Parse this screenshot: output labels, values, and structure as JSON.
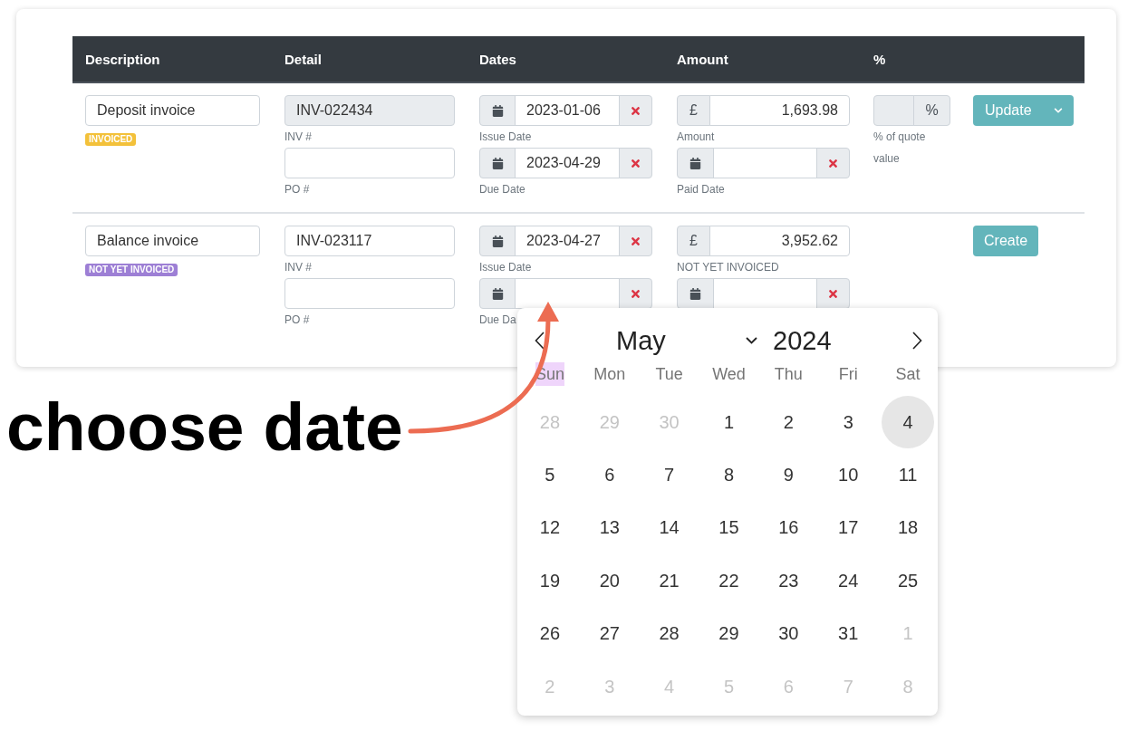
{
  "table": {
    "columns": [
      "Description",
      "Detail",
      "Dates",
      "Amount",
      "%"
    ],
    "rows": [
      {
        "description": "Deposit invoice",
        "badge": {
          "label": "INVOICED",
          "color": "#f3c13a"
        },
        "inv_number": {
          "value": "INV-022434",
          "disabled": true,
          "label": "INV #"
        },
        "po_number": {
          "label": "PO #"
        },
        "issue_date": {
          "value": "2023-01-06",
          "clearable": true,
          "label": "Issue Date"
        },
        "due_date": {
          "value": "2023-04-29",
          "clearable": true,
          "label": "Due Date"
        },
        "amount": {
          "currency": "£",
          "value": "1,693.98",
          "label": "Amount"
        },
        "paid_date": {
          "clearable": true,
          "label": "Paid Date"
        },
        "percent": {
          "unit": "%",
          "disabled": true,
          "label": "% of quote value"
        },
        "action": {
          "label": "Update",
          "dropdown": true
        }
      },
      {
        "description": "Balance invoice",
        "badge": {
          "label": "NOT YET INVOICED",
          "color": "#9d7fd5"
        },
        "inv_number": {
          "value": "INV-023117",
          "disabled": false,
          "label": "INV #"
        },
        "po_number": {
          "label": "PO #"
        },
        "issue_date": {
          "value": "2023-04-27",
          "clearable": true,
          "label": "Issue Date"
        },
        "due_date": {
          "clearable": true,
          "label": "Due Da"
        },
        "amount": {
          "currency": "£",
          "value": "3,952.62",
          "label": "NOT YET INVOICED"
        },
        "paid_date": {
          "clearable": true
        },
        "action": {
          "label": "Create",
          "dropdown": false
        }
      }
    ]
  },
  "date_picker": {
    "month": "May",
    "year": "2024",
    "weekdays": [
      {
        "label": "Sun",
        "highlighted": true
      },
      {
        "label": "Mon",
        "highlighted": false
      },
      {
        "label": "Tue",
        "highlighted": false
      },
      {
        "label": "Wed",
        "highlighted": false
      },
      {
        "label": "Thu",
        "highlighted": false
      },
      {
        "label": "Fri",
        "highlighted": false
      },
      {
        "label": "Sat",
        "highlighted": false
      }
    ],
    "weeks": [
      [
        {
          "label": "28",
          "outside": true,
          "selected": false
        },
        {
          "label": "29",
          "outside": true,
          "selected": false
        },
        {
          "label": "30",
          "outside": true,
          "selected": false
        },
        {
          "label": "1",
          "outside": false,
          "selected": false
        },
        {
          "label": "2",
          "outside": false,
          "selected": false
        },
        {
          "label": "3",
          "outside": false,
          "selected": false
        },
        {
          "label": "4",
          "outside": false,
          "selected": true
        }
      ],
      [
        {
          "label": "5",
          "outside": false,
          "selected": false
        },
        {
          "label": "6",
          "outside": false,
          "selected": false
        },
        {
          "label": "7",
          "outside": false,
          "selected": false
        },
        {
          "label": "8",
          "outside": false,
          "selected": false
        },
        {
          "label": "9",
          "outside": false,
          "selected": false
        },
        {
          "label": "10",
          "outside": false,
          "selected": false
        },
        {
          "label": "11",
          "outside": false,
          "selected": false
        }
      ],
      [
        {
          "label": "12",
          "outside": false,
          "selected": false
        },
        {
          "label": "13",
          "outside": false,
          "selected": false
        },
        {
          "label": "14",
          "outside": false,
          "selected": false
        },
        {
          "label": "15",
          "outside": false,
          "selected": false
        },
        {
          "label": "16",
          "outside": false,
          "selected": false
        },
        {
          "label": "17",
          "outside": false,
          "selected": false
        },
        {
          "label": "18",
          "outside": false,
          "selected": false
        }
      ],
      [
        {
          "label": "19",
          "outside": false,
          "selected": false
        },
        {
          "label": "20",
          "outside": false,
          "selected": false
        },
        {
          "label": "21",
          "outside": false,
          "selected": false
        },
        {
          "label": "22",
          "outside": false,
          "selected": false
        },
        {
          "label": "23",
          "outside": false,
          "selected": false
        },
        {
          "label": "24",
          "outside": false,
          "selected": false
        },
        {
          "label": "25",
          "outside": false,
          "selected": false
        }
      ],
      [
        {
          "label": "26",
          "outside": false,
          "selected": false
        },
        {
          "label": "27",
          "outside": false,
          "selected": false
        },
        {
          "label": "28",
          "outside": false,
          "selected": false
        },
        {
          "label": "29",
          "outside": false,
          "selected": false
        },
        {
          "label": "30",
          "outside": false,
          "selected": false
        },
        {
          "label": "31",
          "outside": false,
          "selected": false
        },
        {
          "label": "1",
          "outside": true,
          "selected": false
        }
      ],
      [
        {
          "label": "2",
          "outside": true,
          "selected": false
        },
        {
          "label": "3",
          "outside": true,
          "selected": false
        },
        {
          "label": "4",
          "outside": true,
          "selected": false
        },
        {
          "label": "5",
          "outside": true,
          "selected": false
        },
        {
          "label": "6",
          "outside": true,
          "selected": false
        },
        {
          "label": "7",
          "outside": true,
          "selected": false
        },
        {
          "label": "8",
          "outside": true,
          "selected": false
        }
      ]
    ]
  },
  "annotation": {
    "text": "choose date"
  }
}
